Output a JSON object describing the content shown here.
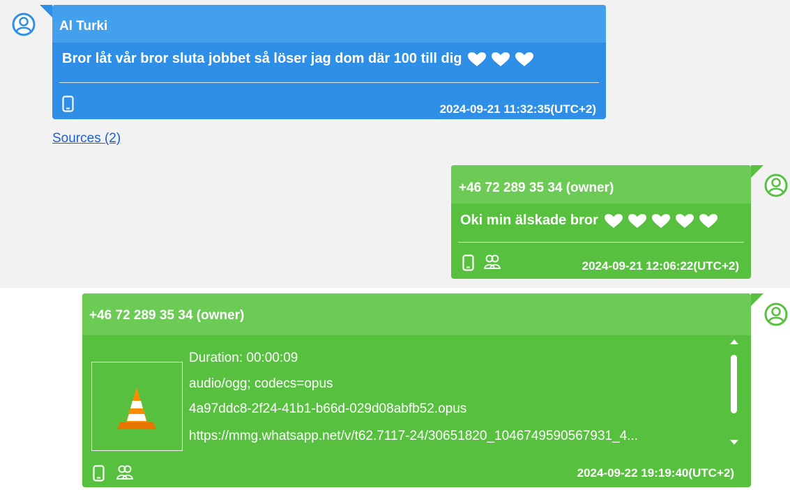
{
  "messages": [
    {
      "sender": "Al Turki",
      "text": "Bror låt vår bror sluta jobbet så löser jag dom där 100 till dig",
      "hearts": 3,
      "timestamp": "2024-09-21 11:32:35(UTC+2)",
      "sources_link": "Sources (2)"
    },
    {
      "sender": "+46 72 289 35 34 (owner)",
      "text": "Oki min älskade bror",
      "hearts": 5,
      "timestamp": "2024-09-21 12:06:22(UTC+2)"
    },
    {
      "sender": "+46 72 289 35 34 (owner)",
      "attachment": {
        "duration": "Duration: 00:00:09",
        "mime": "audio/ogg; codecs=opus",
        "filename": "4a97ddc8-2f24-41b1-b66d-029d08abfb52.opus",
        "url": "https://mmg.whatsapp.net/v/t62.7117-24/30651820_1046749590567931_4..."
      },
      "timestamp": "2024-09-22 19:19:40(UTC+2)"
    }
  ],
  "colors": {
    "incoming": "#2f8fe6",
    "outgoing": "#57c13f",
    "avatar_incoming": "#2f8fe6",
    "avatar_outgoing": "#57c13f",
    "link": "#2060c8"
  },
  "icons": {
    "device": "phone-icon",
    "group": "group-icon",
    "media": "vlc-cone-icon",
    "avatar": "user-avatar-icon"
  }
}
